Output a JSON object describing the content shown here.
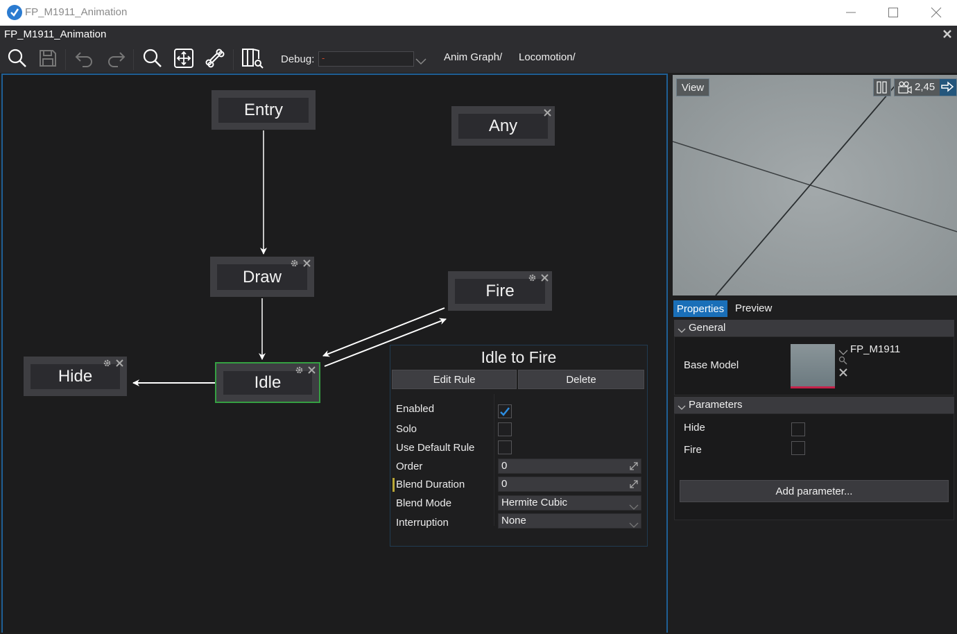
{
  "window": {
    "title": "FP_M1911_Animation"
  },
  "editor": {
    "title": "FP_M1911_Animation",
    "toolbar": {
      "icons": [
        "search-icon",
        "save-icon",
        "undo-icon",
        "redo-icon",
        "zoom-icon",
        "fit-view-icon",
        "bone-icon",
        "docs-search-icon"
      ],
      "debug_label": "Debug:",
      "debug_value": "-"
    },
    "breadcrumbs": [
      "Anim Graph/",
      "Locomotion/"
    ]
  },
  "graph": {
    "nodes": [
      {
        "id": "entry",
        "label": "Entry",
        "removable": false,
        "configurable": false,
        "selected": false
      },
      {
        "id": "any",
        "label": "Any",
        "removable": true,
        "configurable": false,
        "selected": false
      },
      {
        "id": "draw",
        "label": "Draw",
        "removable": true,
        "configurable": true,
        "selected": false
      },
      {
        "id": "fire",
        "label": "Fire",
        "removable": true,
        "configurable": true,
        "selected": false
      },
      {
        "id": "hide",
        "label": "Hide",
        "removable": true,
        "configurable": true,
        "selected": false
      },
      {
        "id": "idle",
        "label": "Idle",
        "removable": true,
        "configurable": true,
        "selected": true
      }
    ],
    "transitions": [
      {
        "from": "entry",
        "to": "draw"
      },
      {
        "from": "draw",
        "to": "idle"
      },
      {
        "from": "idle",
        "to": "hide"
      },
      {
        "from": "idle",
        "to": "fire"
      },
      {
        "from": "fire",
        "to": "idle"
      }
    ],
    "colors": {
      "selected_border": "#35a042",
      "panel_border": "#1f5f96"
    }
  },
  "transition_popup": {
    "title": "Idle to Fire",
    "edit_rule_label": "Edit Rule",
    "delete_label": "Delete",
    "properties": {
      "enabled_label": "Enabled",
      "enabled": true,
      "solo_label": "Solo",
      "solo": false,
      "use_default_rule_label": "Use Default Rule",
      "use_default_rule": false,
      "order_label": "Order",
      "order_value": "0",
      "blend_duration_label": "Blend Duration",
      "blend_duration_value": "0",
      "blend_mode_label": "Blend Mode",
      "blend_mode_value": "Hermite Cubic",
      "interruption_label": "Interruption",
      "interruption_value": "None"
    }
  },
  "viewport": {
    "view_label": "View",
    "camera_speed": "2,45"
  },
  "properties_panel": {
    "tabs": [
      {
        "label": "Properties",
        "active": true
      },
      {
        "label": "Preview",
        "active": false
      }
    ],
    "general": {
      "header": "General",
      "base_model_label": "Base Model",
      "base_model_value": "FP_M1911"
    },
    "parameters": {
      "header": "Parameters",
      "items": [
        {
          "label": "Hide",
          "checked": false
        },
        {
          "label": "Fire",
          "checked": false
        }
      ],
      "add_label": "Add parameter..."
    }
  }
}
